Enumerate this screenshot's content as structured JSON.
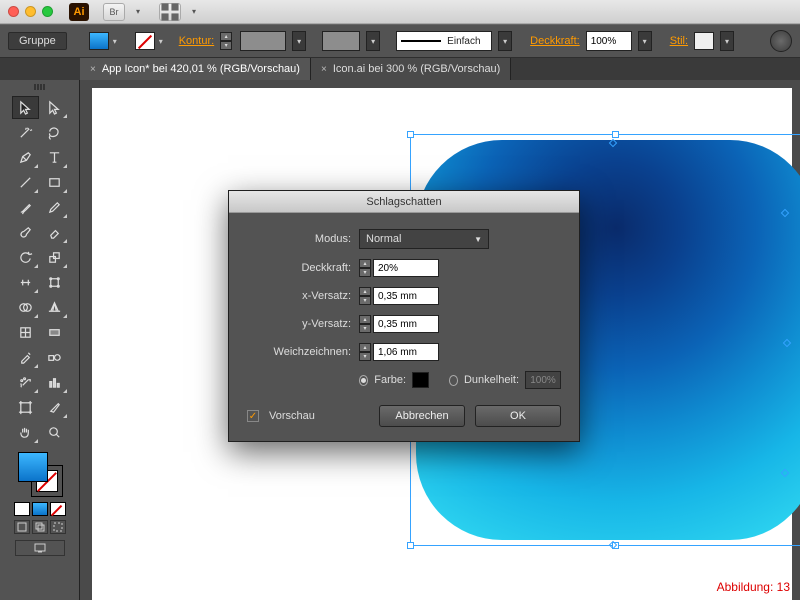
{
  "titlebar": {
    "app_badge": "Ai",
    "bridge_btn": "Br"
  },
  "controlbar": {
    "group_label": "Gruppe",
    "kontur_label": "Kontur:",
    "stroke_style": "Einfach",
    "deckkraft_label": "Deckkraft:",
    "deckkraft_value": "100%",
    "stil_label": "Stil:"
  },
  "tabs": [
    {
      "label": "App Icon* bei 420,01 % (RGB/Vorschau)",
      "active": true
    },
    {
      "label": "Icon.ai bei 300 % (RGB/Vorschau)",
      "active": false
    }
  ],
  "dialog": {
    "title": "Schlagschatten",
    "modus_label": "Modus:",
    "modus_value": "Normal",
    "deckkraft_label": "Deckkraft:",
    "deckkraft_value": "20%",
    "x_label": "x-Versatz:",
    "x_value": "0,35 mm",
    "y_label": "y-Versatz:",
    "y_value": "0,35 mm",
    "blur_label": "Weichzeichnen:",
    "blur_value": "1,06 mm",
    "farbe_label": "Farbe:",
    "dunkel_label": "Dunkelheit:",
    "dunkel_value": "100%",
    "preview_label": "Vorschau",
    "cancel": "Abbrechen",
    "ok": "OK"
  },
  "caption": "Abbildung: 13"
}
